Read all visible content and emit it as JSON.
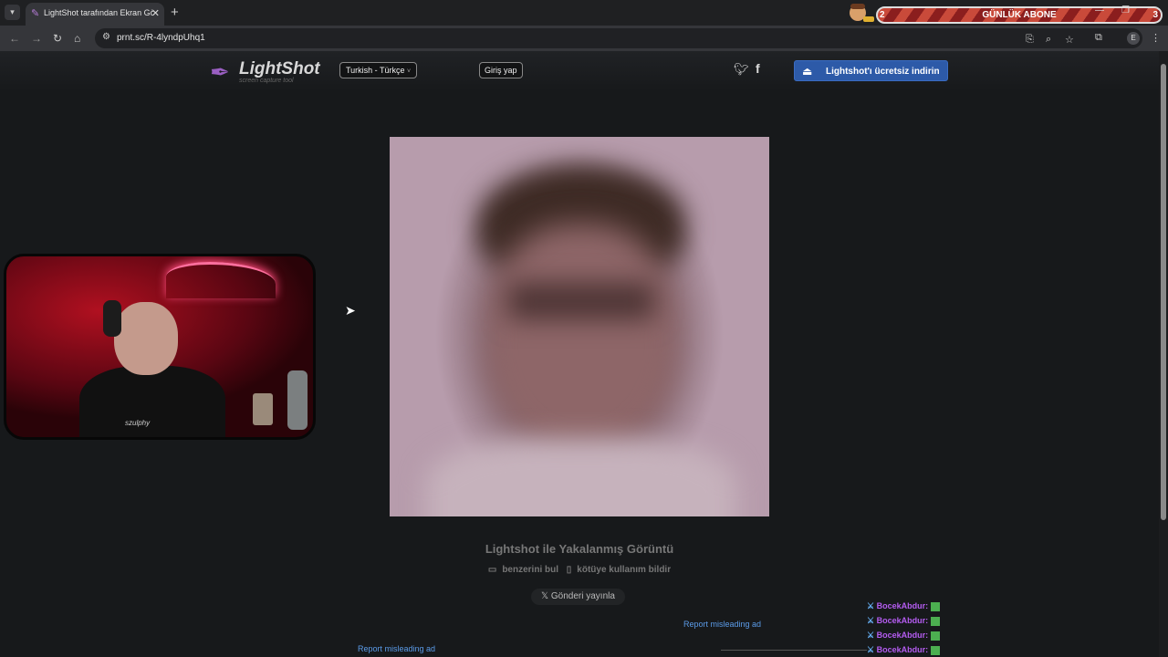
{
  "browser": {
    "tab_title": "LightShot tarafından Ekran Görü",
    "tab_close": "✕",
    "new_tab": "+",
    "url": "prnt.sc/R-4lyndpUhq1",
    "subscriber_goal": {
      "current": "2",
      "label": "GÜNLÜK ABONE",
      "target": "3"
    }
  },
  "header": {
    "logo_text": "LightShot",
    "logo_subtitle": "screen capture tool",
    "language": "Turkish - Türkçe",
    "login": "Giriş yap",
    "download_button": "Lightshot'ı ücretsiz indirin"
  },
  "content": {
    "caption": "Lightshot ile Yakalanmış Görüntü",
    "find_similar": "benzerini bul",
    "report_abuse": "kötüye kullanım bildir",
    "tweet_button": "Gönderi yayınla",
    "report_ad_1": "Report misleading ad",
    "report_ad_2": "Report misleading ad"
  },
  "chat": {
    "messages": [
      {
        "user": "BocekAbdur:"
      },
      {
        "user": "BocekAbdur:"
      },
      {
        "user": "BocekAbdur:"
      },
      {
        "user": "BocekAbdur:"
      }
    ]
  },
  "webcam": {
    "shirt_logo": "szulphy"
  },
  "colors": {
    "accent": "#2d5aa8",
    "link": "#5b9be8",
    "chat_user": "#b45cf0",
    "background": "#17191b"
  }
}
